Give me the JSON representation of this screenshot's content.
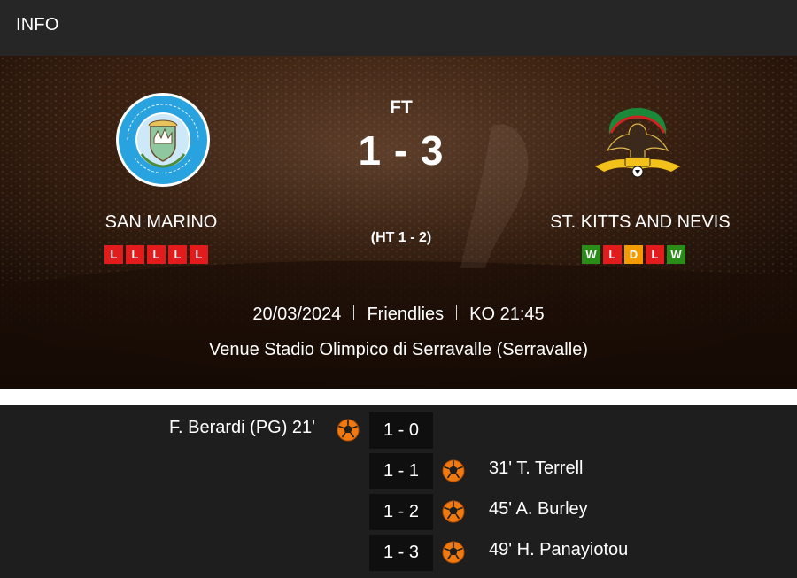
{
  "header": {
    "title": "INFO"
  },
  "match": {
    "status": "FT",
    "score": "1 - 3",
    "half_time": "(HT 1 - 2)",
    "date": "20/03/2024",
    "competition": "Friendlies",
    "kickoff": "KO 21:45",
    "venue": "Venue Stadio Olimpico di Serravalle (Serravalle)"
  },
  "home": {
    "name": "SAN MARINO",
    "crest_icon": "san-marino-federation-crest-icon",
    "form": [
      "L",
      "L",
      "L",
      "L",
      "L"
    ]
  },
  "away": {
    "name": "ST. KITTS AND NEVIS",
    "crest_icon": "st-kitts-and-nevis-federation-crest-icon",
    "form": [
      "W",
      "L",
      "D",
      "L",
      "W"
    ]
  },
  "events": [
    {
      "side": "home",
      "text": "F. Berardi (PG) 21'",
      "score": "1 - 0",
      "icon": "goal-ball-icon"
    },
    {
      "side": "away",
      "text": "31' T. Terrell",
      "score": "1 - 1",
      "icon": "goal-ball-icon"
    },
    {
      "side": "away",
      "text": "45' A. Burley",
      "score": "1 - 2",
      "icon": "goal-ball-icon"
    },
    {
      "side": "away",
      "text": "49' H. Panayiotou",
      "score": "1 - 3",
      "icon": "goal-ball-icon"
    }
  ],
  "colors": {
    "loss": "#e21c1c",
    "win": "#2a8d19",
    "draw": "#f39b00",
    "goal_icon": "#f07a10",
    "header_bg": "#262626",
    "events_bg": "#1e1e1e"
  }
}
